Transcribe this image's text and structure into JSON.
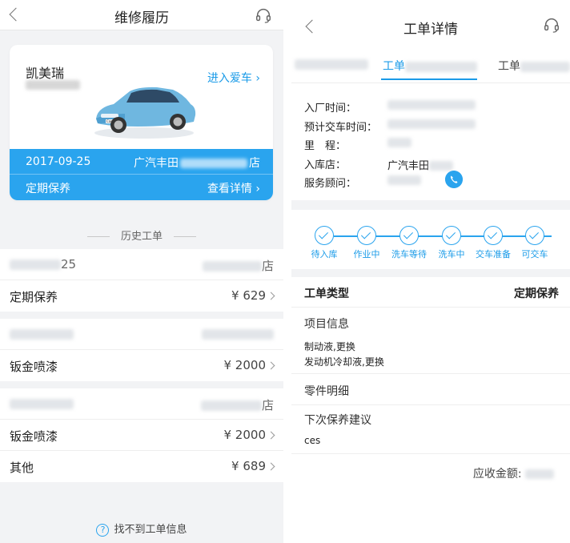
{
  "left": {
    "title": "维修履历",
    "car": {
      "name": "凯美瑞",
      "enter_label": "进入爱车",
      "date": "2017-09-25",
      "store_prefix": "广汽丰田",
      "store_suffix": "店",
      "service_type": "定期保养",
      "detail_label": "查看详情"
    },
    "history_title": "历史工单",
    "groups": [
      {
        "store_suffix": "店",
        "items": [
          {
            "label": "定期保养",
            "amount": "¥ 629"
          }
        ]
      },
      {
        "store_suffix": "",
        "items": [
          {
            "label": "钣金喷漆",
            "amount": "¥ 2000"
          }
        ]
      },
      {
        "store_suffix": "店",
        "items": [
          {
            "label": "钣金喷漆",
            "amount": "¥ 2000"
          },
          {
            "label": "其他",
            "amount": "¥ 689"
          }
        ]
      }
    ],
    "group0_date_suffix": "25",
    "help_label": "找不到工单信息"
  },
  "right": {
    "title": "工单详情",
    "tabs": [
      "工单",
      "工单"
    ],
    "info": {
      "in_time_label": "入厂时间：",
      "eta_label": "预计交车时间：",
      "mileage_label": "里　程：",
      "store_label": "入库店：",
      "store_value": "广汽丰田",
      "advisor_label": "服务顾问："
    },
    "steps": [
      "待入库",
      "作业中",
      "洗车等待",
      "洗车中",
      "交车准备",
      "可交车"
    ],
    "order_type_label": "工单类型",
    "order_type_value": "定期保养",
    "project_info_label": "项目信息",
    "projects": [
      "制动液,更换",
      "发动机冷却液,更换"
    ],
    "parts_label": "零件明细",
    "next_advice_label": "下次保养建议",
    "next_advice_value": "ces",
    "amount_label": "应收金额:"
  },
  "icons": {
    "back": "back-chevron-icon",
    "headset": "headset-icon",
    "phone": "phone-icon",
    "help": "question-circle-icon",
    "check": "check-circle-icon"
  },
  "colors": {
    "accent": "#2aa4ee",
    "link": "#1a9be8",
    "background": "#f2f3f5"
  }
}
